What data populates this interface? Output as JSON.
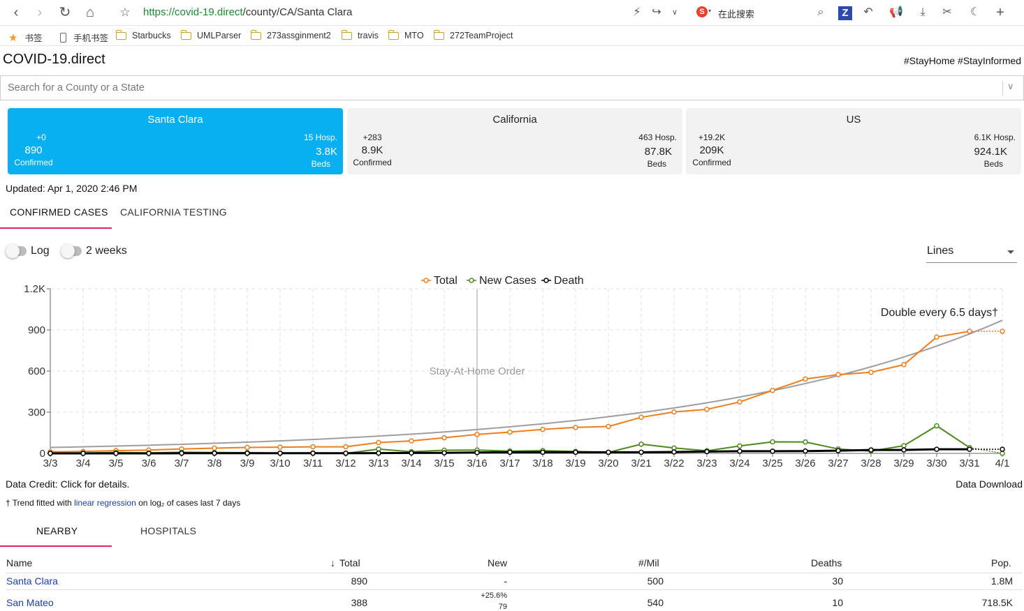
{
  "browser": {
    "url_proto": "https://",
    "url_host": "covid-19.direct",
    "url_path": "/county/CA/Santa Clara",
    "search_engine_label": "在此搜索",
    "bookmarks": [
      "书签",
      "手机书签",
      "Starbucks",
      "UMLParser",
      "273assginment2",
      "travis",
      "MTO",
      "272TeamProject"
    ]
  },
  "app": {
    "title": "COVID-19.direct",
    "tagline": "#StayHome #StayInformed",
    "search_placeholder": "Search for a County or a State",
    "updated": "Updated: Apr 1, 2020 2:46 PM",
    "colors": {
      "active_card": "#08b0f2",
      "tab_indicator": "#e0245e",
      "total": "#f07c1a",
      "new_cases": "#4a8a1c",
      "death": "#000000",
      "trend": "#9e9e9e"
    }
  },
  "cards": [
    {
      "name": "Santa Clara",
      "delta": "+0",
      "confirmed": "890",
      "confirmed_label": "Confirmed",
      "hosp": "15 Hosp.",
      "beds": "3.8K",
      "beds_label": "Beds"
    },
    {
      "name": "California",
      "delta": "+283",
      "confirmed": "8.9K",
      "confirmed_label": "Confirmed",
      "hosp": "463 Hosp.",
      "beds": "87.8K",
      "beds_label": "Beds"
    },
    {
      "name": "US",
      "delta": "+19.2K",
      "confirmed": "209K",
      "confirmed_label": "Confirmed",
      "hosp": "6.1K Hosp.",
      "beds": "924.1K",
      "beds_label": "Beds"
    }
  ],
  "tabs": [
    "CONFIRMED CASES",
    "CALIFORNIA TESTING"
  ],
  "controls": {
    "log_label": "Log",
    "two_weeks_label": "2 weeks",
    "view_select_value": "Lines"
  },
  "chart_data": {
    "type": "line",
    "legend": [
      "Total",
      "New Cases",
      "Death"
    ],
    "legend_position": "top-center",
    "categories": [
      "3/3",
      "3/4",
      "3/5",
      "3/6",
      "3/7",
      "3/8",
      "3/9",
      "3/10",
      "3/11",
      "3/12",
      "3/13",
      "3/14",
      "3/15",
      "3/16",
      "3/17",
      "3/18",
      "3/19",
      "3/20",
      "3/21",
      "3/22",
      "3/23",
      "3/24",
      "3/25",
      "3/26",
      "3/27",
      "3/28",
      "3/29",
      "3/30",
      "3/31",
      "4/1"
    ],
    "y_ticks": [
      "0",
      "300",
      "600",
      "900",
      "1.2K"
    ],
    "ylim": [
      0,
      1200
    ],
    "grid": true,
    "series": [
      {
        "name": "Total",
        "values": [
          11,
          14,
          20,
          24,
          32,
          38,
          43,
          45,
          48,
          48,
          79,
          91,
          114,
          138,
          155,
          175,
          189,
          196,
          263,
          302,
          321,
          375,
          459,
          542,
          574,
          591,
          647,
          848,
          890,
          890
        ]
      },
      {
        "name": "New Cases",
        "values": [
          2,
          3,
          6,
          4,
          8,
          6,
          5,
          2,
          3,
          0,
          31,
          12,
          23,
          24,
          17,
          20,
          14,
          7,
          67,
          39,
          19,
          54,
          84,
          83,
          32,
          17,
          56,
          201,
          42,
          0
        ]
      },
      {
        "name": "Death",
        "values": [
          0,
          0,
          0,
          0,
          1,
          1,
          1,
          1,
          1,
          1,
          2,
          3,
          4,
          6,
          8,
          8,
          8,
          8,
          8,
          10,
          13,
          16,
          16,
          17,
          20,
          25,
          25,
          30,
          30,
          30
        ]
      }
    ],
    "annotations": [
      {
        "text": "Stay-At-Home Order",
        "x": "3/16"
      },
      {
        "text": "Double every 6.5 days†"
      }
    ],
    "trend": {
      "y_start": 43,
      "y_end": 970
    }
  },
  "credits": {
    "data_credit": "Data Credit: Click for details.",
    "data_download": "Data Download",
    "trend_note_prefix": "† Trend fitted with ",
    "trend_note_link": "linear regression",
    "trend_note_suffix": " on log₂ of cases last 7 days"
  },
  "tabs2": [
    "NEARBY",
    "HOSPITALS"
  ],
  "table": {
    "headers": {
      "name": "Name",
      "total": "Total",
      "new": "New",
      "per_mil": "#/Mil",
      "deaths": "Deaths",
      "pop": "Pop."
    },
    "rows": [
      {
        "name": "Santa Clara",
        "total": "890",
        "new": "-",
        "new_pct": "",
        "per_mil": "500",
        "deaths": "30",
        "pop": "1.8M"
      },
      {
        "name": "San Mateo",
        "total": "388",
        "new": "79",
        "new_pct": "+25.6%",
        "per_mil": "540",
        "deaths": "10",
        "pop": "718.5K"
      }
    ]
  }
}
